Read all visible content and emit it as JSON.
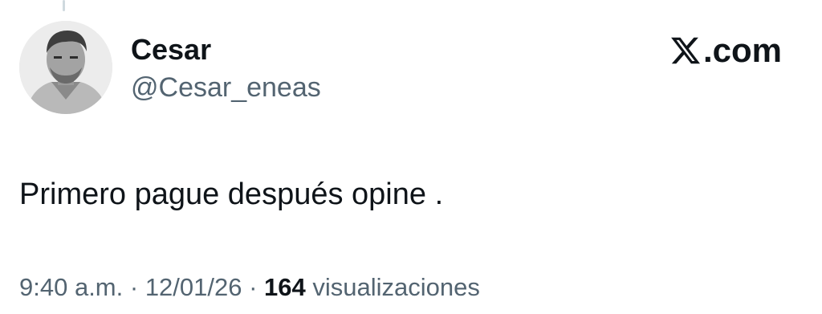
{
  "author": {
    "display_name": "Cesar",
    "handle": "@Cesar_eneas",
    "avatar_icon": "profile-photo"
  },
  "brand": {
    "icon": "x-logo-icon",
    "suffix": ".com"
  },
  "tweet": {
    "text": "Primero pague después opine ."
  },
  "meta": {
    "time": "9:40 a.m.",
    "separator": " · ",
    "date": "12/01/26",
    "views_count": "164",
    "views_label": " visualizaciones"
  },
  "colors": {
    "text_primary": "#0f1419",
    "text_secondary": "#536471",
    "thread_line": "#cfd9de"
  }
}
